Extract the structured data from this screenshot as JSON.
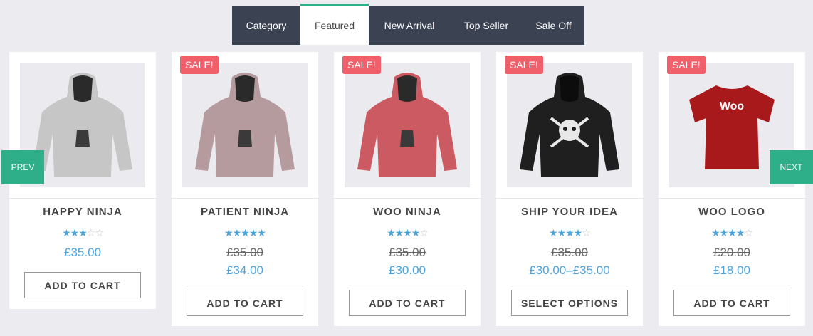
{
  "tabs": [
    {
      "label": "Category"
    },
    {
      "label": "Featured"
    },
    {
      "label": "New Arrival"
    },
    {
      "label": "Top Seller"
    },
    {
      "label": "Sale Off"
    }
  ],
  "nav": {
    "prev": "PREV",
    "next": "NEXT"
  },
  "sale_badge": "SALE!",
  "products": [
    {
      "name": "HAPPY NINJA",
      "rating": 3,
      "old_price": "",
      "price": "£35.00",
      "button": "ADD TO CART",
      "sale": false
    },
    {
      "name": "PATIENT NINJA",
      "rating": 4.5,
      "old_price": "£35.00",
      "price": "£34.00",
      "button": "ADD TO CART",
      "sale": true
    },
    {
      "name": "WOO NINJA",
      "rating": 4.5,
      "old_price": "£35.00",
      "price": "£30.00",
      "button": "ADD TO CART",
      "sale": true
    },
    {
      "name": "SHIP YOUR IDEA",
      "rating": 4,
      "old_price": "£35.00",
      "price": "£30.00–£35.00",
      "button": "SELECT OPTIONS",
      "sale": true
    },
    {
      "name": "WOO LOGO",
      "rating": 4,
      "old_price": "£20.00",
      "price": "£18.00",
      "button": "ADD TO CART",
      "sale": true
    }
  ],
  "colors": {
    "accent": "#2eaf8a",
    "price": "#4aa3df",
    "sale": "#f0606a",
    "tabbar": "#3b4252"
  }
}
